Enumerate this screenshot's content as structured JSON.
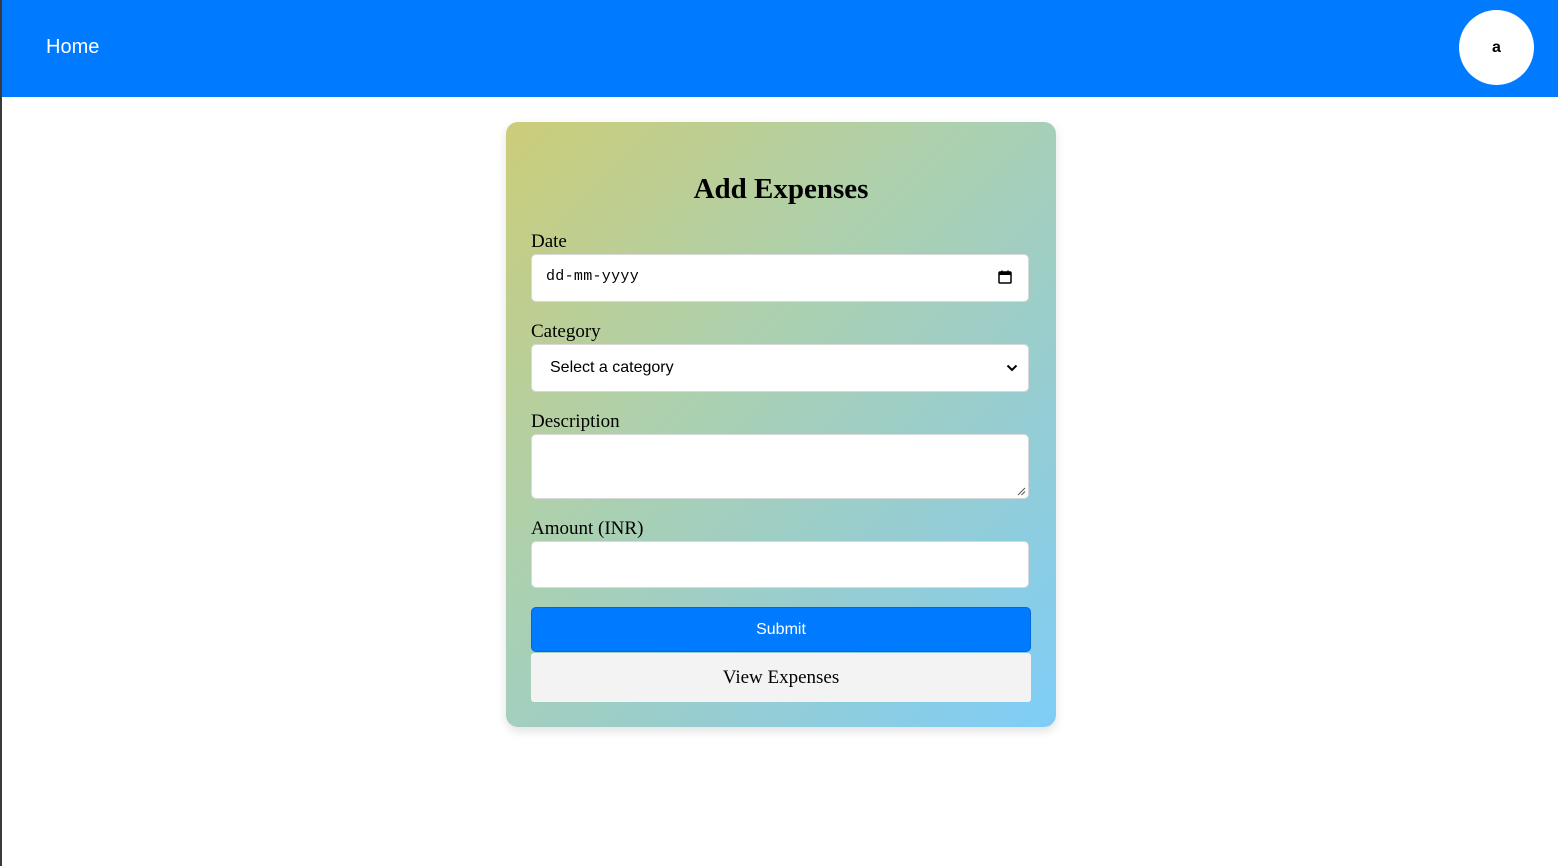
{
  "nav": {
    "home_label": "Home",
    "avatar_initial": "a",
    "bar_color": "#007bff"
  },
  "form": {
    "title": "Add Expenses",
    "date": {
      "label": "Date",
      "placeholder": "dd-mm-yyyy",
      "icon": "calendar-icon"
    },
    "category": {
      "label": "Category",
      "selected": "Select a category",
      "icon": "chevron-down-icon"
    },
    "description": {
      "label": "Description",
      "value": ""
    },
    "amount": {
      "label": "Amount (INR)",
      "value": ""
    },
    "submit_label": "Submit",
    "view_label": "View Expenses",
    "submit_color": "#007bff"
  }
}
